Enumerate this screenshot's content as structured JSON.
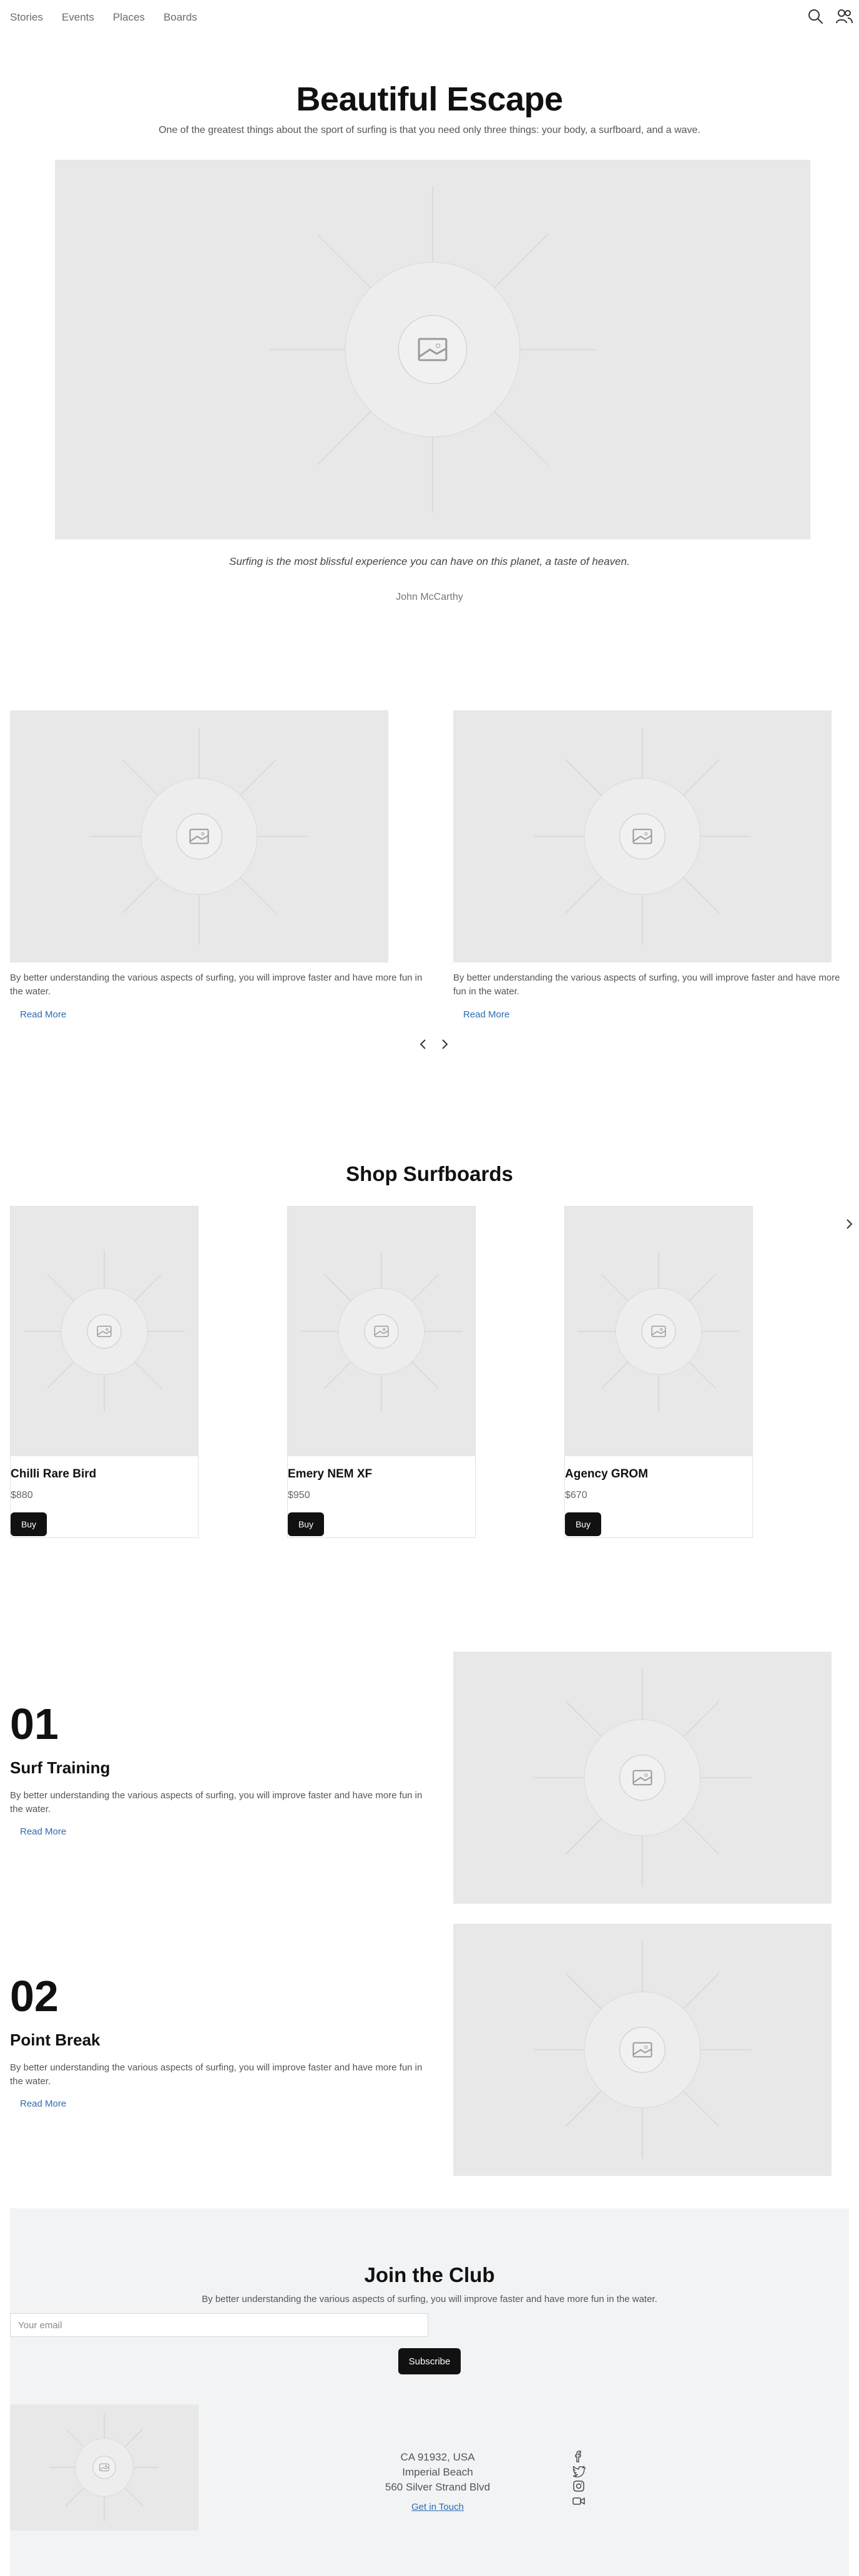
{
  "nav": {
    "items": [
      "Stories",
      "Events",
      "Places",
      "Boards"
    ]
  },
  "header": {
    "search_icon": "search-icon",
    "user_icon": "users-icon"
  },
  "hero": {
    "title": "Beautiful Escape",
    "subtitle": "One of the greatest things about the sport of surfing is that you need only three things: your body, a surfboard, and a wave.",
    "quote": "Surfing is the most blissful experience you can have on this planet, a taste of heaven.",
    "quote_author": "John McCarthy"
  },
  "stories": {
    "cards": [
      {
        "text": "By better understanding the various aspects of surfing, you will improve faster and have more fun in the water.",
        "link": "Read More"
      },
      {
        "text": "By better understanding the various aspects of surfing, you will improve faster and have more fun in the water.",
        "link": "Read More"
      }
    ]
  },
  "shop": {
    "title": "Shop Surfboards",
    "products": [
      {
        "name": "Chilli Rare Bird",
        "price": "$880",
        "button": "Buy"
      },
      {
        "name": "Emery NEM XF",
        "price": "$950",
        "button": "Buy"
      },
      {
        "name": "Agency GROM",
        "price": "$670",
        "button": "Buy"
      }
    ]
  },
  "features": [
    {
      "number": "01",
      "title": "Surf Training",
      "text": "By better understanding the various aspects of surfing, you will improve faster and have more fun in the water.",
      "link": "Read More"
    },
    {
      "number": "02",
      "title": "Point Break",
      "text": "By better understanding the various aspects of surfing, you will improve faster and have more fun in the water.",
      "link": "Read More"
    }
  ],
  "club": {
    "title": "Join the Club",
    "subtitle": "By better understanding the various aspects of surfing, you will improve faster and have more fun in the water.",
    "email_placeholder": "Your email",
    "subscribe": "Subscribe",
    "address": [
      "CA 91932, USA",
      "Imperial Beach",
      "560 Silver Strand Blvd"
    ],
    "contact_link": "Get in Touch",
    "social_icons": [
      "facebook-icon",
      "twitter-icon",
      "instagram-icon",
      "video-icon"
    ]
  },
  "colors": {
    "accent_link": "#2b6cb0",
    "button": "#111111",
    "placeholder_bg": "#e8e8e8",
    "club_bg": "#f2f3f5"
  }
}
